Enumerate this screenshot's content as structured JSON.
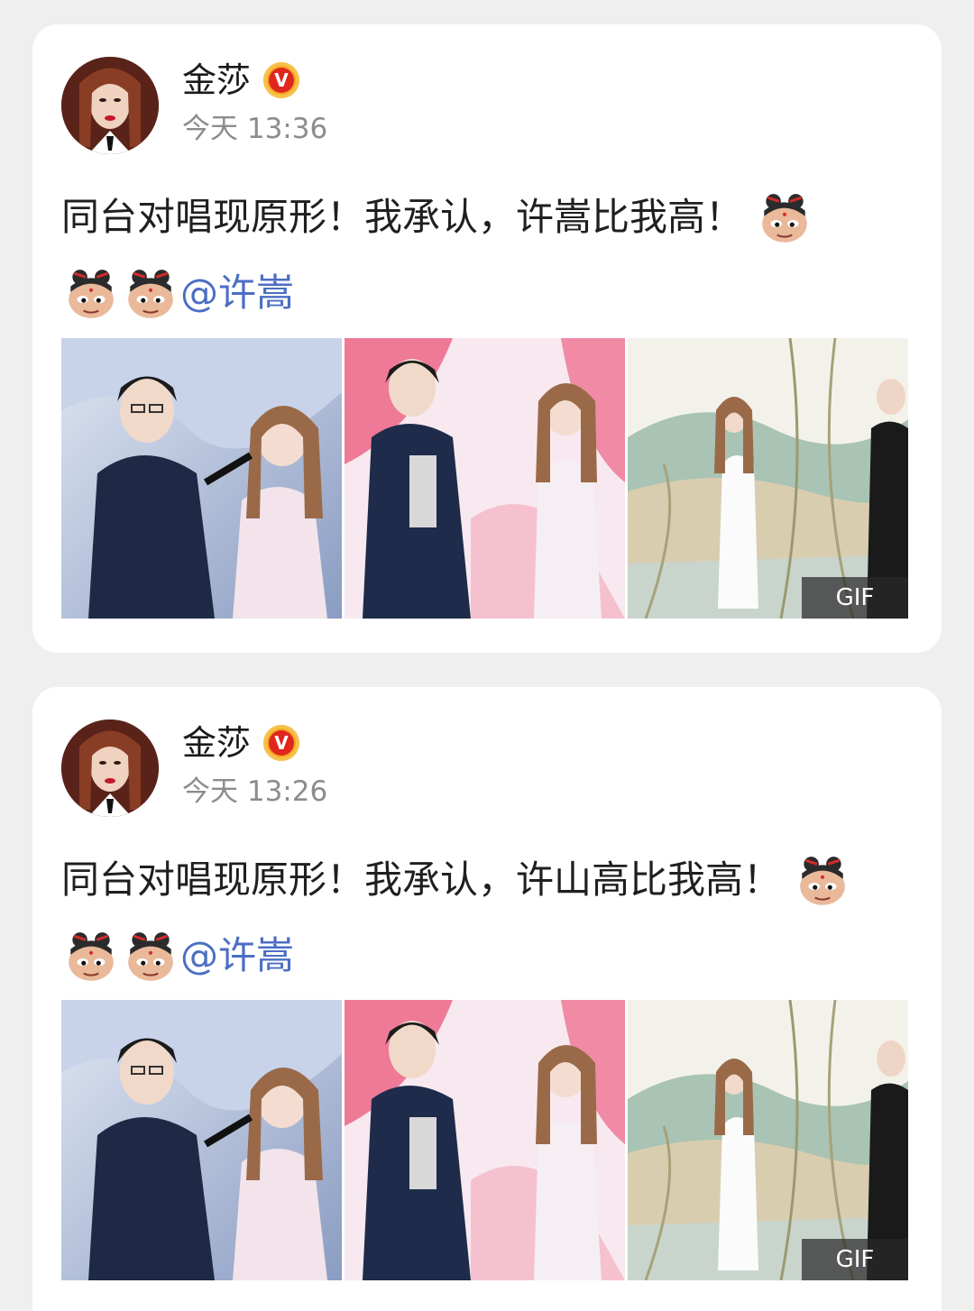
{
  "posts": [
    {
      "user": "金莎",
      "verified": true,
      "time": "今天 13:36",
      "text": "同台对唱现原形！我承认，许嵩比我高！",
      "mention": "@许嵩",
      "emoji_name": "nezha-emoji",
      "images": [
        {
          "name": "stage-photo-1"
        },
        {
          "name": "stage-photo-2"
        },
        {
          "name": "stage-photo-3",
          "badge": "GIF"
        }
      ]
    },
    {
      "user": "金莎",
      "verified": true,
      "time": "今天 13:26",
      "text": "同台对唱现原形！我承认，许山高比我高！",
      "mention": "@许嵩",
      "emoji_name": "nezha-emoji",
      "images": [
        {
          "name": "stage-photo-1"
        },
        {
          "name": "stage-photo-2"
        },
        {
          "name": "stage-photo-3",
          "badge": "GIF"
        }
      ]
    }
  ],
  "colors": {
    "background": "#efefef",
    "card": "#ffffff",
    "mention": "#4b6ec4",
    "verified_badge": "#e0261d"
  }
}
